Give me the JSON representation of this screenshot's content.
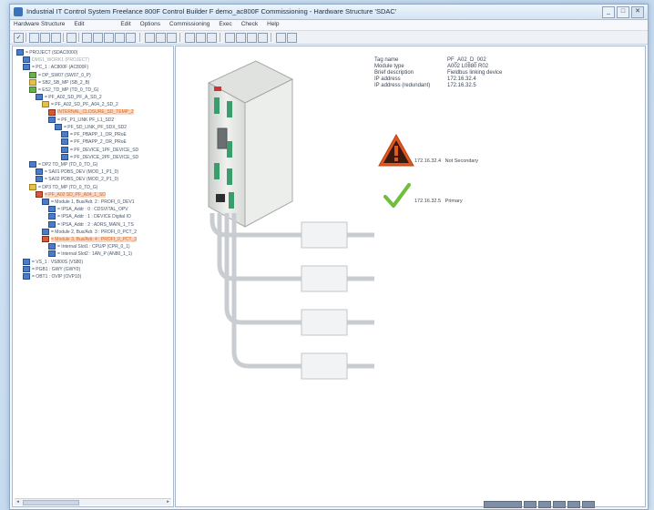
{
  "window": {
    "title": "Industrial IT Control System Freelance 800F Control Builder F demo_ac800F Commissioning - Hardware Structure 'SDAC'",
    "buttons": {
      "minimize": "_",
      "maximize": "□",
      "close": "✕"
    }
  },
  "menu": {
    "items": [
      "Hardware Structure",
      "Edit",
      "Edit",
      "Options",
      "Commissioning",
      "Exec",
      "Check",
      "Help"
    ]
  },
  "tree": {
    "rows": [
      {
        "indent": 0,
        "text": "= PROJECT (SDAC0000)",
        "icon": "blue",
        "style": "normal"
      },
      {
        "indent": 1,
        "text": "DMS1_WORK1 (PROJECT)",
        "icon": "blue",
        "style": "fade"
      },
      {
        "indent": 1,
        "text": "= PC_1 : AC800F (AC800F)",
        "icon": "blue",
        "style": "normal"
      },
      {
        "indent": 2,
        "text": "= DP_SW07 (SW07_0_P)",
        "icon": "green",
        "style": "normal"
      },
      {
        "indent": 2,
        "text": "= SB2_SB_MP (SB_2_B)",
        "icon": "yellow",
        "style": "normal"
      },
      {
        "indent": 2,
        "text": "= ES2_TD_MP (TD_0_TD_G)",
        "icon": "green",
        "style": "normal"
      },
      {
        "indent": 3,
        "text": "= PF_A02_SD_PF_A_SD_2",
        "icon": "blue",
        "style": "normal"
      },
      {
        "indent": 4,
        "text": "= PF_A02_SD_PF_A04_2_SD_2",
        "icon": "yellow",
        "style": "normal"
      },
      {
        "indent": 5,
        "text": "INTERNAL_CLOSURE_SD_TEMP_2",
        "icon": "red",
        "style": "orange"
      },
      {
        "indent": 5,
        "text": "= PF_P1_LINK PF_L1_SD2",
        "icon": "blue",
        "style": "normal"
      },
      {
        "indent": 6,
        "text": "= PF_SD_LINK_PF_SDX_SD2",
        "icon": "blue",
        "style": "normal"
      },
      {
        "indent": 7,
        "text": "= PF_PBAPP_1_OR_PRoE",
        "icon": "blue",
        "style": "normal"
      },
      {
        "indent": 7,
        "text": "= PF_PBAPP_2_OR_PRoE",
        "icon": "blue",
        "style": "normal"
      },
      {
        "indent": 7,
        "text": "= PF_DEVICE_1PF_DEVICE_SD",
        "icon": "blue",
        "style": "normal"
      },
      {
        "indent": 7,
        "text": "= PF_DEVICE_2PF_DEVICE_SD",
        "icon": "blue",
        "style": "normal"
      },
      {
        "indent": 2,
        "text": "= DP2 TD_MP (TD_0_TD_G)",
        "icon": "blue",
        "style": "normal"
      },
      {
        "indent": 3,
        "text": "= SA01 PDBS_DEV (MOD_1_P1_0)",
        "icon": "blue",
        "style": "normal"
      },
      {
        "indent": 3,
        "text": "= SA02 PDBS_DEV (MOD_2_P1_0)",
        "icon": "blue",
        "style": "normal"
      },
      {
        "indent": 2,
        "text": "= DP3 TD_MP (TD_0_TD_G)",
        "icon": "yellow",
        "style": "normal"
      },
      {
        "indent": 3,
        "text": "= PF_A02 SD_PF_A04_1_SD",
        "icon": "red",
        "style": "orange"
      },
      {
        "indent": 4,
        "text": "= Module 1, Bus/Adr. 2 : PROFI_0_DEV1",
        "icon": "blue",
        "style": "normal"
      },
      {
        "indent": 5,
        "text": "= IPSA_Addr : 0 : CDSVITAL_OPV",
        "icon": "blue",
        "style": "normal"
      },
      {
        "indent": 5,
        "text": "= IPSA_Addr : 1 : DEVICE Digital IO",
        "icon": "blue",
        "style": "normal"
      },
      {
        "indent": 5,
        "text": "= IPSA_Addr : 2 : ADRS_MAIN_1_TS",
        "icon": "blue",
        "style": "normal"
      },
      {
        "indent": 4,
        "text": "= Module 2, Bus/Adr. 3 : PROFI_0_PCT_2",
        "icon": "blue",
        "style": "normal"
      },
      {
        "indent": 4,
        "text": "= Module 3, Bus/Adr. 4 : PROFI_0_PCT_3",
        "icon": "red",
        "style": "orange"
      },
      {
        "indent": 5,
        "text": "= Internal Slot1 : CPU/P (CPR_0_1)",
        "icon": "blue",
        "style": "normal"
      },
      {
        "indent": 5,
        "text": "= Internal Slot2 : 1AN_P (AN80_1_1)",
        "icon": "blue",
        "style": "normal"
      },
      {
        "indent": 1,
        "text": "= VS_1 : VS800S (VS80)",
        "icon": "blue",
        "style": "normal"
      },
      {
        "indent": 1,
        "text": "= PGB1 : GWY (GWY0)",
        "icon": "blue",
        "style": "normal"
      },
      {
        "indent": 1,
        "text": "= OBT1 : OVIP (OVP10)",
        "icon": "blue",
        "style": "normal"
      }
    ]
  },
  "details": {
    "properties": [
      {
        "key": "Tag name",
        "value": "PF_A02_D_002"
      },
      {
        "key": "Module type",
        "value": "A002 L0880 R02"
      },
      {
        "key": "Brief description",
        "value": "Fieldbus linking device"
      },
      {
        "key": "IP address",
        "value": "172.16.32.4"
      },
      {
        "key": "IP address (redundant)",
        "value": "172.16.32.5"
      }
    ],
    "alarm": {
      "address": "172.16.32.4",
      "status": "Not Secondary"
    },
    "ok": {
      "address": "172.16.32.5",
      "status": "Primary"
    }
  },
  "colors": {
    "warning": "#e2571e",
    "ok": "#6fbe3c",
    "device_body": "#e9ebe8",
    "connector": "#3a9d6b"
  },
  "icons": {
    "warning": "warning-triangle-icon",
    "ok": "checkmark-icon"
  }
}
